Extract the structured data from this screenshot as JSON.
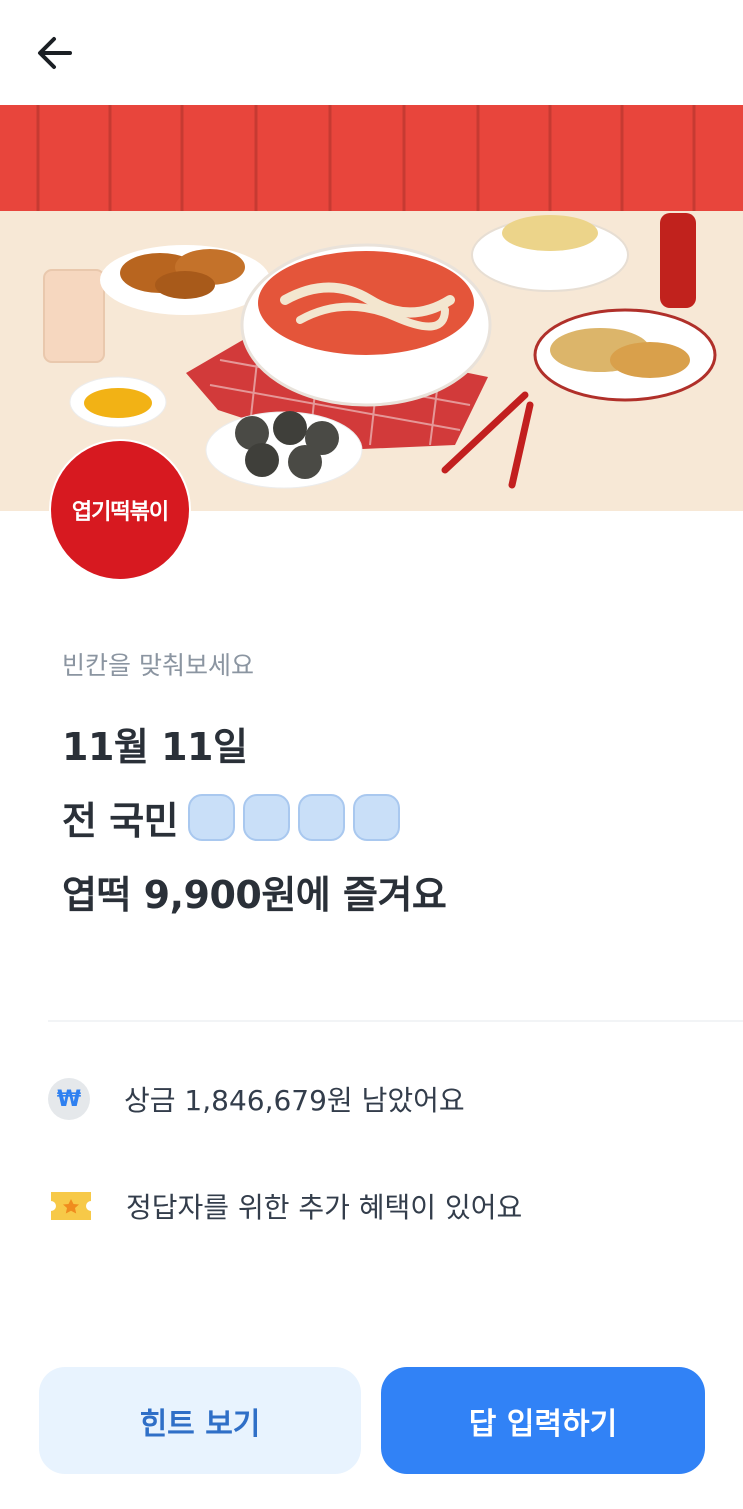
{
  "header": {
    "back_icon": "arrow-left-icon"
  },
  "hero": {
    "image": "food-spread-photo"
  },
  "brand": {
    "logo_text": "엽기떡볶이",
    "logo_color": "#d71920"
  },
  "quiz": {
    "label": "빈칸을 맞춰보세요",
    "line1": "11월 11일",
    "line2_prefix": "전 국민",
    "blank_count": 4,
    "line3": "엽떡 9,900원에 즐겨요"
  },
  "info": {
    "prize_icon": "won-coin-icon",
    "prize_symbol": "₩",
    "prize_text": "상금 1,846,679원 남았어요",
    "bonus_icon": "ticket-icon",
    "bonus_text": "정답자를 위한 추가 혜택이 있어요"
  },
  "actions": {
    "hint_label": "힌트 보기",
    "answer_label": "답 입력하기"
  },
  "colors": {
    "primary": "#3182f6",
    "hint_bg": "#e8f3fe",
    "blank_fill": "#c9dff8"
  }
}
